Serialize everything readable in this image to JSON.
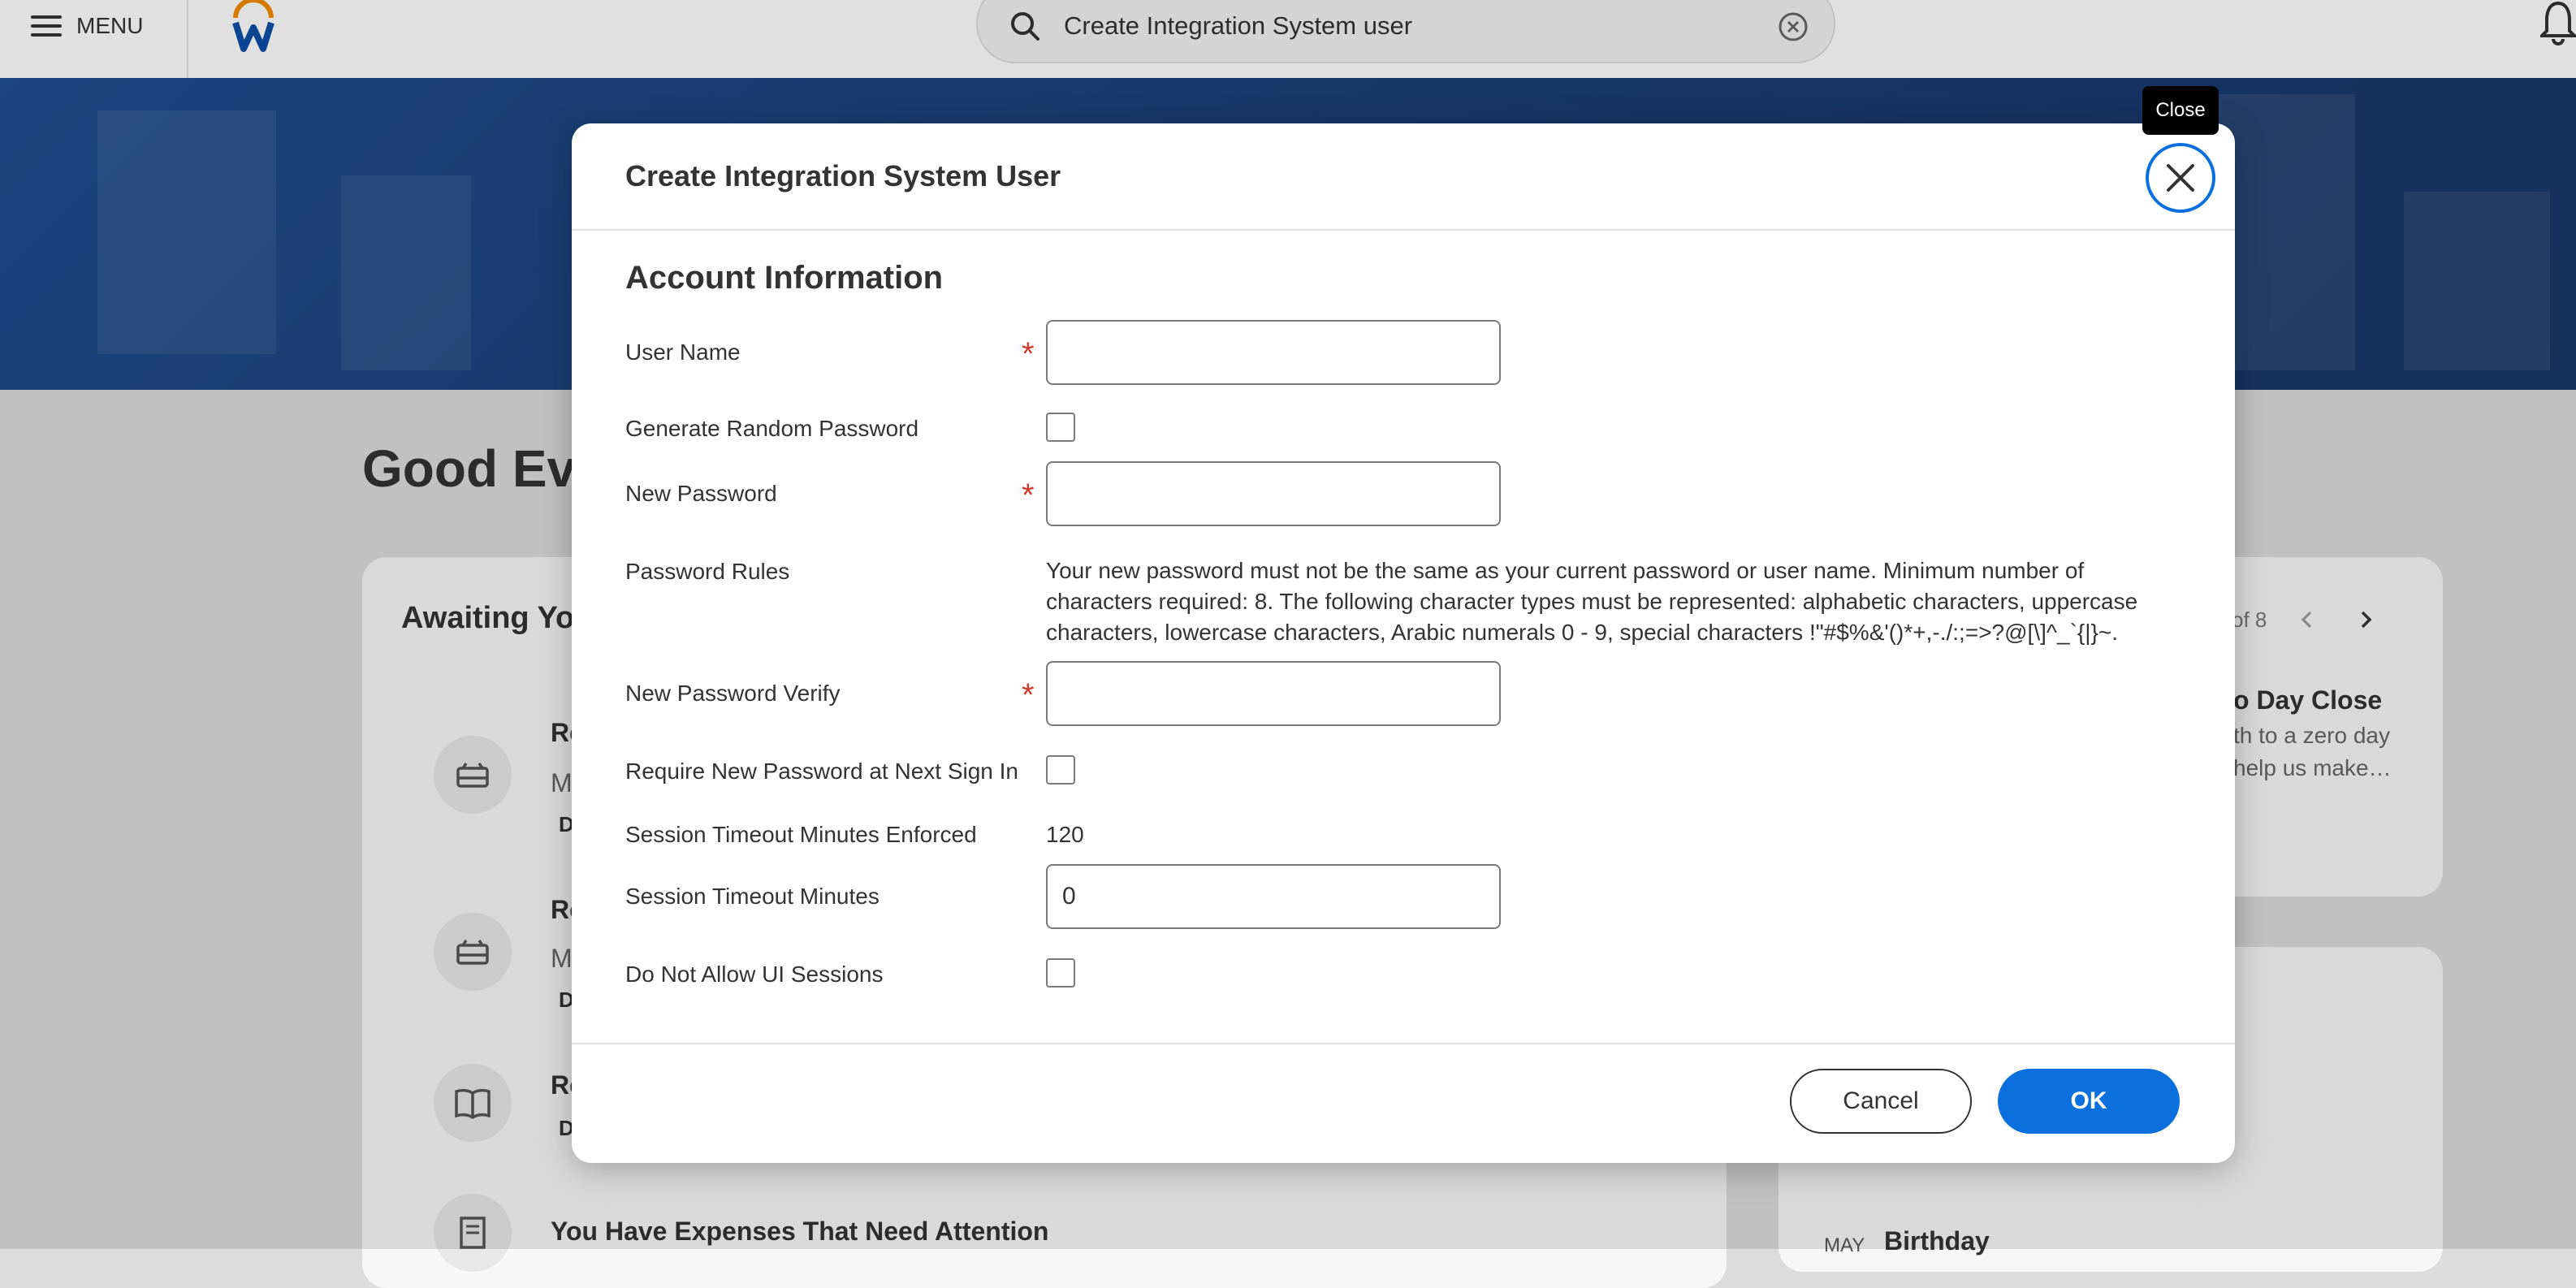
{
  "topbar": {
    "menu_label": "MENU",
    "search_value": "Create Integration System user"
  },
  "background": {
    "greeting": "Good Eve",
    "awaiting_title": "Awaiting Yo",
    "tasks": [
      {
        "line1": "Re",
        "line2": "M",
        "line3": "D"
      },
      {
        "line1": "Re",
        "line2": "M",
        "line3": "D"
      },
      {
        "line1": "Re",
        "line2": "D"
      }
    ],
    "expenses_title": "You Have Expenses That Need Attention",
    "pager": "of 8",
    "right_card_title": "o Day Close",
    "right_card_text_1": "th to a zero day",
    "right_card_text_2": "help us make…",
    "birthday_month": "MAY",
    "birthday_title": "Birthday"
  },
  "dialog": {
    "title": "Create Integration System User",
    "close_tooltip": "Close",
    "section_title": "Account Information",
    "fields": {
      "user_name_label": "User Name",
      "user_name_value": "",
      "generate_random_password_label": "Generate Random Password",
      "new_password_label": "New Password",
      "new_password_value": "",
      "password_rules_label": "Password Rules",
      "password_rules_text": "Your new password must not be the same as your current password or user name. Minimum number of characters required: 8. The following character types must be represented: alphabetic characters, uppercase characters, lowercase characters, Arabic numerals 0 - 9, special characters !\"#$%&'()*+,-./:;=>?@[\\]^_`{|}~.",
      "new_password_verify_label": "New Password Verify",
      "new_password_verify_value": "",
      "require_new_password_label": "Require New Password at Next Sign In",
      "session_timeout_enforced_label": "Session Timeout Minutes Enforced",
      "session_timeout_enforced_value": "120",
      "session_timeout_minutes_label": "Session Timeout Minutes",
      "session_timeout_minutes_value": "0",
      "do_not_allow_ui_label": "Do Not Allow UI Sessions"
    },
    "required_marker": "*",
    "cancel_label": "Cancel",
    "ok_label": "OK"
  },
  "colors": {
    "accent": "#0b6fde",
    "required": "#d13a2c"
  }
}
